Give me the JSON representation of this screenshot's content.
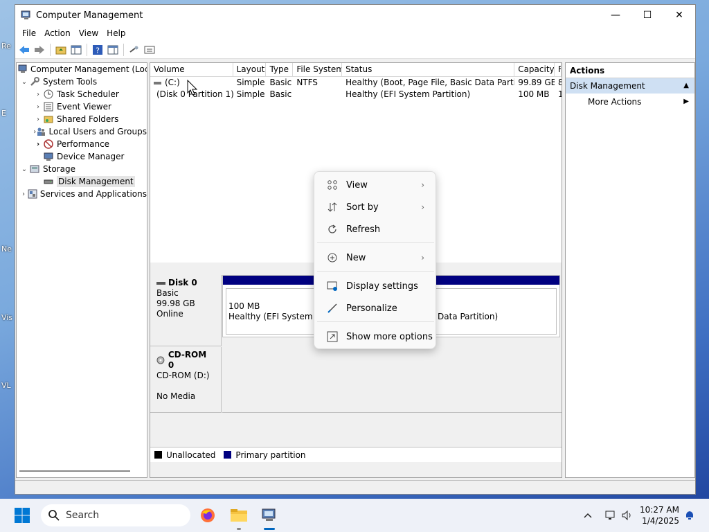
{
  "desktop": {
    "labels": [
      "Re",
      "E",
      "Ne",
      "Vis",
      "VL"
    ]
  },
  "window": {
    "title": "Computer Management",
    "controls": {
      "minimize": "—",
      "maximize": "☐",
      "close": "✕"
    }
  },
  "menu": [
    "File",
    "Action",
    "View",
    "Help"
  ],
  "tree": {
    "root": "Computer Management (Local",
    "system_tools": "System Tools",
    "task_scheduler": "Task Scheduler",
    "event_viewer": "Event Viewer",
    "shared_folders": "Shared Folders",
    "local_users": "Local Users and Groups",
    "performance": "Performance",
    "device_manager": "Device Manager",
    "storage": "Storage",
    "disk_management": "Disk Management",
    "services": "Services and Applications"
  },
  "volumes": {
    "headers": [
      "Volume",
      "Layout",
      "Type",
      "File System",
      "Status",
      "Capacity",
      "F"
    ],
    "rows": [
      [
        "(C:)",
        "Simple",
        "Basic",
        "NTFS",
        "Healthy (Boot, Page File, Basic Data Partition)",
        "99.89 GB",
        "8"
      ],
      [
        "(Disk 0 Partition 1)",
        "Simple",
        "Basic",
        "",
        "Healthy (EFI System Partition)",
        "100 MB",
        "1"
      ]
    ]
  },
  "disks": {
    "disk0": {
      "name": "Disk 0",
      "type": "Basic",
      "size": "99.98 GB",
      "state": "Online",
      "part1_size": "100 MB",
      "part1_status": "Healthy (EFI System Par",
      "part2_status": "Data Partition)"
    },
    "cdrom": {
      "name": "CD-ROM 0",
      "drive": "CD-ROM (D:)",
      "state": "No Media"
    }
  },
  "legend": {
    "unallocated": "Unallocated",
    "primary": "Primary partition"
  },
  "colors": {
    "unallocated": "#000000",
    "primary": "#000080",
    "accent": "#0067c0"
  },
  "actions": {
    "header": "Actions",
    "section": "Disk Management",
    "more": "More Actions"
  },
  "context_menu": {
    "view": "View",
    "sort_by": "Sort by",
    "refresh": "Refresh",
    "new": "New",
    "display_settings": "Display settings",
    "personalize": "Personalize",
    "show_more": "Show more options"
  },
  "taskbar": {
    "search_placeholder": "Search",
    "time": "10:27 AM",
    "date": "1/4/2025"
  }
}
